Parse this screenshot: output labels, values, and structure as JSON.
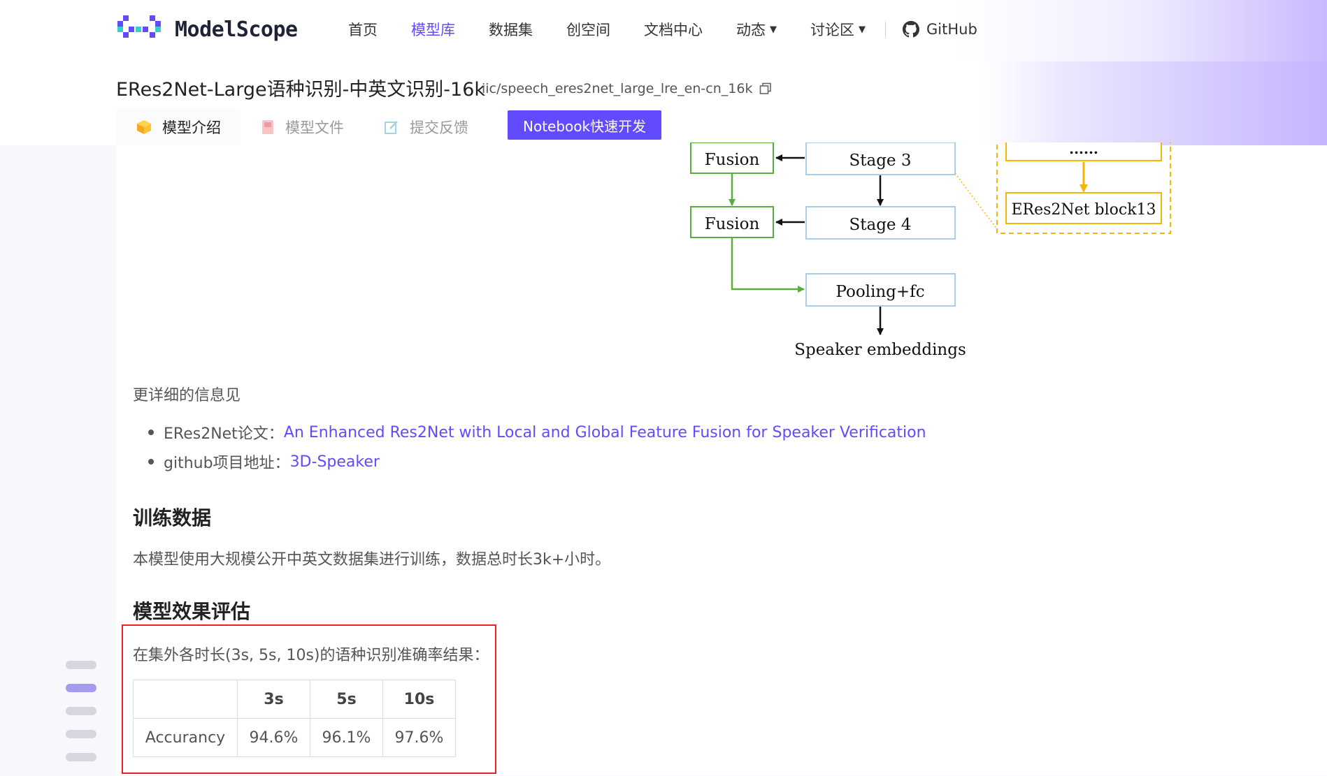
{
  "header": {
    "logo_text": "ModelScope",
    "nav": [
      {
        "label": "首页",
        "active": false,
        "dropdown": false
      },
      {
        "label": "模型库",
        "active": true,
        "dropdown": false
      },
      {
        "label": "数据集",
        "active": false,
        "dropdown": false
      },
      {
        "label": "创空间",
        "active": false,
        "dropdown": false
      },
      {
        "label": "文档中心",
        "active": false,
        "dropdown": false
      },
      {
        "label": "动态",
        "active": false,
        "dropdown": true
      },
      {
        "label": "讨论区",
        "active": false,
        "dropdown": true
      }
    ],
    "github_label": "GitHub"
  },
  "model": {
    "title": "ERes2Net-Large语种识别-中英文识别-16k",
    "path": "iic/speech_eres2net_large_lre_en-cn_16k",
    "tabs": [
      {
        "label": "模型介绍",
        "icon": "cube-icon",
        "active": true
      },
      {
        "label": "模型文件",
        "icon": "file-icon",
        "active": false
      },
      {
        "label": "提交反馈",
        "icon": "feedback-icon",
        "active": false
      }
    ],
    "notebook_label": "Notebook快速开发"
  },
  "diagram": {
    "fusion_1": "Fusion",
    "fusion_2": "Fusion",
    "stage_3": "Stage 3",
    "stage_4": "Stage 4",
    "pooling": "Pooling+fc",
    "embeddings": "Speaker embeddings",
    "dots": "......",
    "block13": "ERes2Net block13"
  },
  "content": {
    "info_line": "更详细的信息见",
    "refs": [
      {
        "prefix": "ERes2Net论文：",
        "link": "An Enhanced Res2Net with Local and Global Feature Fusion for Speaker Verification"
      },
      {
        "prefix": "github项目地址：",
        "link": "3D-Speaker"
      }
    ],
    "train_heading": "训练数据",
    "train_text": "本模型使用大规模公开中英文数据集进行训练，数据总时长3k+小时。",
    "eval_heading": "模型效果评估",
    "eval_desc": "在集外各时长(3s, 5s, 10s)的语种识别准确率结果：",
    "table": {
      "headers": [
        "",
        "3s",
        "5s",
        "10s"
      ],
      "row_label": "Accurancy",
      "values": [
        "94.6%",
        "96.1%",
        "97.6%"
      ]
    }
  },
  "colors": {
    "brand": "#624aff",
    "fusion_green": "#5aac3c",
    "stage_blue": "#a9cce8",
    "block_yellow": "#f2b705",
    "highlight_red": "#e8202a"
  }
}
